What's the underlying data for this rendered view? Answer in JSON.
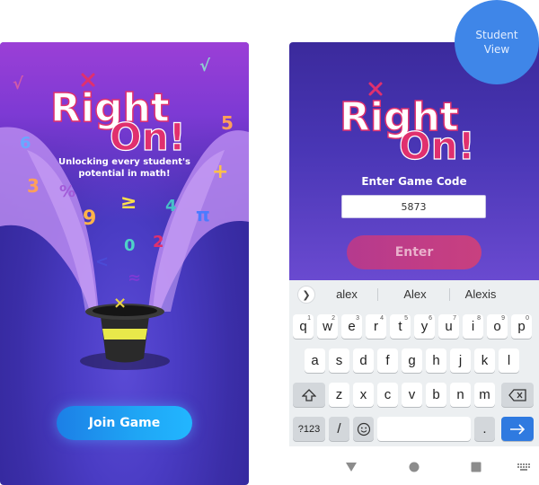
{
  "left_screen": {
    "logo": {
      "word1": "Right",
      "word2": "On!"
    },
    "tagline_line1": "Unlocking every student's",
    "tagline_line2": "potential in math!",
    "join_button": "Join Game",
    "math_symbols": [
      "√",
      "√",
      "6",
      "5",
      "3",
      "%",
      "+",
      "9",
      "≥",
      "4",
      "π",
      "0",
      "2",
      "<",
      "≈",
      "×"
    ]
  },
  "right_screen": {
    "logo": {
      "word1": "Right",
      "word2": "On!"
    },
    "code_label": "Enter Game Code",
    "code_value": "5873",
    "enter_button": "Enter",
    "keyboard": {
      "suggestions": [
        "alex",
        "Alex",
        "Alexis"
      ],
      "row1": [
        "q",
        "w",
        "e",
        "r",
        "t",
        "y",
        "u",
        "i",
        "o",
        "p"
      ],
      "row1_hints": [
        "1",
        "2",
        "3",
        "4",
        "5",
        "6",
        "7",
        "8",
        "9",
        "0"
      ],
      "row2": [
        "a",
        "s",
        "d",
        "f",
        "g",
        "h",
        "j",
        "k",
        "l"
      ],
      "row3": [
        "z",
        "x",
        "c",
        "v",
        "b",
        "n",
        "m"
      ],
      "symbols_key": "?123",
      "slash_key": "/",
      "period_key": "."
    }
  },
  "badge": {
    "line1": "Student",
    "line2": "View"
  },
  "colors": {
    "join": "#1fa6f5",
    "enter": "#c23d85",
    "badge": "#3f86e8",
    "logo_accent": "#e0306e"
  }
}
